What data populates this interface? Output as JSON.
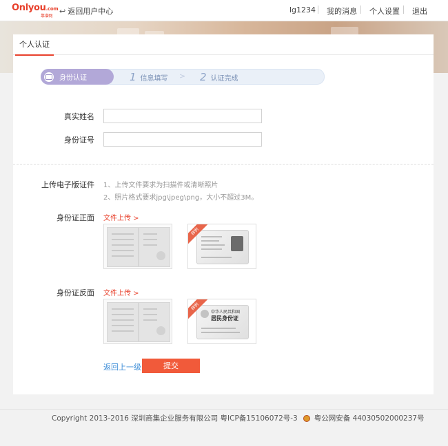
{
  "header": {
    "logo_main": "Onlyou",
    "logo_domain": ".com",
    "logo_sub": "靠谱网",
    "back_center": "返回用户中心",
    "back_icon": "return-arrow-icon",
    "user": "lg1234",
    "nav": [
      "我的消息",
      "个人设置",
      "退出"
    ]
  },
  "tab": {
    "label": "个人认证"
  },
  "steps": {
    "active": "身份认证",
    "step1_num": "1",
    "step1_label": "信息填写",
    "step2_num": "2",
    "step2_label": "认证完成",
    "chevron": ">"
  },
  "form": {
    "name_label": "真实姓名",
    "name_value": "",
    "id_label": "身份证号",
    "id_value": ""
  },
  "upload": {
    "title": "上传电子版证件",
    "hint1": "1、上传文件要求为扫描件或清晰照片",
    "hint2": "2、照片格式要求jpg\\jpeg\\png，大小不超过3M。",
    "front_label": "身份证正面",
    "back_label": "身份证反面",
    "link": "文件上传 >",
    "sample_tag": "样例",
    "back_card_title": "中华人民共和国",
    "back_card_big": "居民身份证"
  },
  "actions": {
    "back": "返回上一级",
    "submit": "提交"
  },
  "footer": {
    "copyright": "Copyright 2013-2016 深圳商集企业服务有限公司 粤ICP备15106072号-3",
    "police": "粤公网安备 44030502000237号"
  },
  "colors": {
    "accent": "#e8402b",
    "submit": "#f15a3a",
    "link": "#3b8cd7",
    "step_active": "#b2a8d8"
  }
}
